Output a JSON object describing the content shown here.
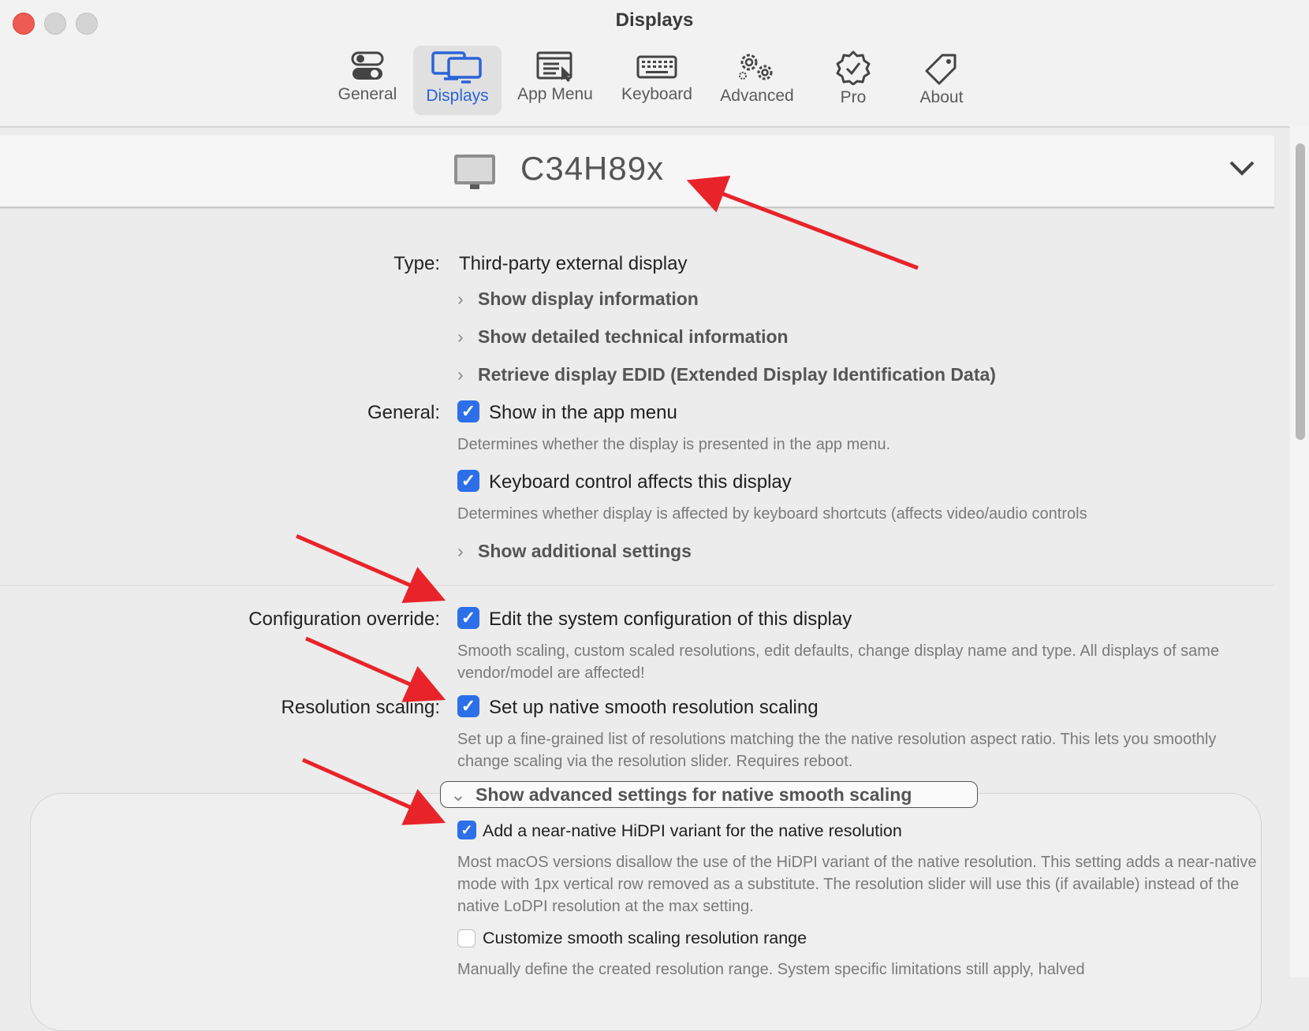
{
  "window": {
    "title": "Displays"
  },
  "toolbar": {
    "items": [
      {
        "label": "General",
        "icon": "toggle-switches-icon",
        "active": false
      },
      {
        "label": "Displays",
        "icon": "displays-icon",
        "active": true
      },
      {
        "label": "App Menu",
        "icon": "app-menu-icon",
        "active": false
      },
      {
        "label": "Keyboard",
        "icon": "keyboard-icon",
        "active": false
      },
      {
        "label": "Advanced",
        "icon": "gears-icon",
        "active": false
      },
      {
        "label": "Pro",
        "icon": "verified-badge-icon",
        "active": false
      },
      {
        "label": "About",
        "icon": "tag-icon",
        "active": false
      }
    ]
  },
  "display": {
    "name": "C34H89x",
    "icon": "monitor-icon"
  },
  "type_section": {
    "label": "Type:",
    "value": "Third-party external display",
    "links": [
      "Show display information",
      "Show detailed technical information",
      "Retrieve display EDID (Extended Display Identification Data)"
    ]
  },
  "general_section": {
    "label": "General:",
    "show_in_menu": {
      "label": "Show in the app menu",
      "checked": true,
      "description": "Determines whether the display is presented in the app menu."
    },
    "keyboard_control": {
      "label": "Keyboard control affects this display",
      "checked": true,
      "description": "Determines whether display is affected by keyboard shortcuts (affects video/audio controls"
    },
    "additional_link": "Show additional settings"
  },
  "config_section": {
    "label": "Configuration override:",
    "option": {
      "label": "Edit the system configuration of this display",
      "checked": true,
      "description": "Smooth scaling, custom scaled resolutions, edit defaults, change display name and type. All displays of same vendor/model are affected!"
    }
  },
  "scaling_section": {
    "label": "Resolution scaling:",
    "option": {
      "label": "Set up native smooth resolution scaling",
      "checked": true,
      "description": "Set up a fine-grained list of resolutions matching the the native resolution aspect ratio. This lets you smoothly change scaling via the resolution slider. Requires reboot."
    }
  },
  "advanced_section": {
    "button_label": "Show advanced settings for native smooth scaling",
    "hidpi": {
      "label": "Add a near-native HiDPI variant for the native resolution",
      "checked": true,
      "description": "Most macOS versions disallow the use of the HiDPI variant of the native resolution. This setting adds a near-native mode with 1px vertical row removed as a substitute. The resolution slider will use this (if available) instead of the native LoDPI resolution at the max setting."
    },
    "customize_range": {
      "label": "Customize smooth scaling resolution range",
      "checked": false,
      "description": "Manually define the created resolution range. System specific limitations still apply, halved"
    }
  },
  "colors": {
    "accent": "#2c6fe8",
    "annotation_arrow": "#e8242a"
  }
}
